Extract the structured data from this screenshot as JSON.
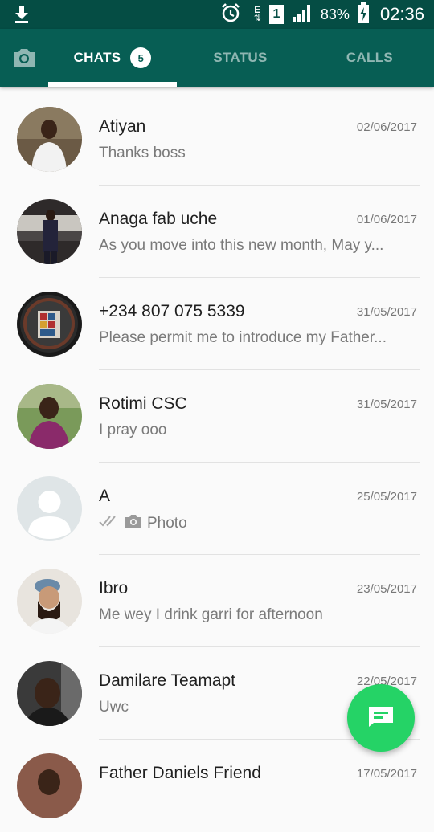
{
  "status_bar": {
    "battery": "83%",
    "time": "02:36",
    "network_type": "E",
    "sim_slot": "1",
    "icons": [
      "download-icon",
      "alarm-icon",
      "signal-icon",
      "battery-charging-icon"
    ]
  },
  "tabs": [
    {
      "label": "CHATS",
      "badge": "5",
      "active": true
    },
    {
      "label": "STATUS",
      "active": false
    },
    {
      "label": "CALLS",
      "active": false
    }
  ],
  "colors": {
    "primary": "#075e54",
    "status_bar": "#054d44",
    "fab": "#25d366"
  },
  "chats": [
    {
      "name": "Atiyan",
      "date": "02/06/2017",
      "message": "Thanks boss"
    },
    {
      "name": "Anaga fab uche",
      "date": "01/06/2017",
      "message": "As you move into this new month, May y..."
    },
    {
      "name": "+234 807 075 5339",
      "date": "31/05/2017",
      "message": "Please permit me to introduce my Father..."
    },
    {
      "name": "Rotimi CSC",
      "date": "31/05/2017",
      "message": "I pray ooo"
    },
    {
      "name": "A",
      "date": "25/05/2017",
      "message": "Photo",
      "icons": [
        "double-check-icon",
        "camera-icon"
      ]
    },
    {
      "name": "Ibro",
      "date": "23/05/2017",
      "message": "Me wey I drink garri for afternoon"
    },
    {
      "name": "Damilare Teamapt",
      "date": "22/05/2017",
      "message": "Uwc"
    },
    {
      "name": "Father Daniels Friend",
      "date": "17/05/2017",
      "message": ""
    }
  ],
  "fab": {
    "icon": "new-chat-icon"
  }
}
